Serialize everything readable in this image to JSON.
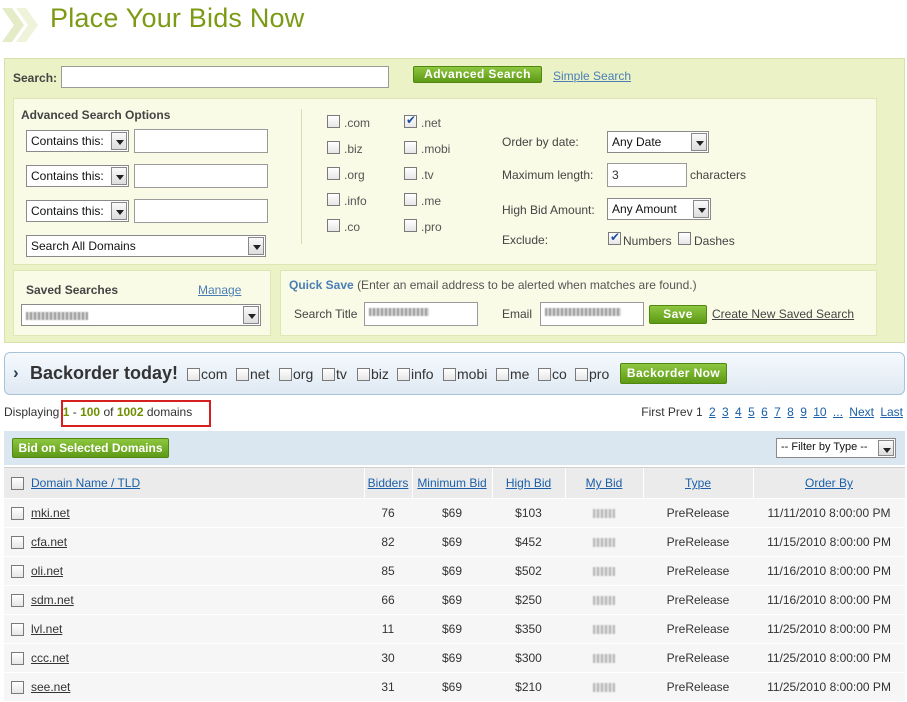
{
  "header": {
    "title": "Place Your Bids Now"
  },
  "search": {
    "label": "Search:",
    "value": "",
    "advanced_button": "Advanced Search",
    "simple_link": "Simple Search"
  },
  "advanced": {
    "title": "Advanced Search Options",
    "contains_rows": [
      {
        "select": "Contains this:",
        "value": ""
      },
      {
        "select": "Contains this:",
        "value": ""
      },
      {
        "select": "Contains this:",
        "value": ""
      }
    ],
    "scope_select": "Search All Domains",
    "tlds": [
      {
        "label": ".com",
        "checked": false
      },
      {
        "label": ".net",
        "checked": true
      },
      {
        "label": ".biz",
        "checked": false
      },
      {
        "label": ".mobi",
        "checked": false
      },
      {
        "label": ".org",
        "checked": false
      },
      {
        "label": ".tv",
        "checked": false
      },
      {
        "label": ".info",
        "checked": false
      },
      {
        "label": ".me",
        "checked": false
      },
      {
        "label": ".co",
        "checked": false
      },
      {
        "label": ".pro",
        "checked": false
      }
    ],
    "order_by_date_label": "Order by date:",
    "order_by_date_value": "Any Date",
    "max_length_label": "Maximum length:",
    "max_length_value": "3",
    "max_length_unit": "characters",
    "high_bid_label": "High Bid Amount:",
    "high_bid_value": "Any Amount",
    "exclude_label": "Exclude:",
    "exclude_numbers": "Numbers",
    "exclude_numbers_checked": true,
    "exclude_dashes": "Dashes",
    "exclude_dashes_checked": false
  },
  "saved": {
    "title": "Saved Searches",
    "manage": "Manage"
  },
  "quick_save": {
    "title": "Quick Save",
    "hint": "(Enter an email address to be alerted when matches are found.)",
    "search_title_label": "Search Title",
    "email_label": "Email",
    "save_button": "Save",
    "create_link": "Create New Saved Search"
  },
  "backorder": {
    "title": "Backorder today!",
    "tlds": [
      "com",
      "net",
      "org",
      "tv",
      "biz",
      "info",
      "mobi",
      "me",
      "co",
      "pro"
    ],
    "button": "Backorder Now"
  },
  "results": {
    "prefix": "Displaying",
    "from": "1",
    "dash": "-",
    "to": "100",
    "of": "of",
    "total": "1002",
    "suffix": "domains",
    "pager": {
      "first": "First",
      "prev": "Prev",
      "current": "1",
      "pages": [
        "2",
        "3",
        "4",
        "5",
        "6",
        "7",
        "8",
        "9",
        "10"
      ],
      "more": "...",
      "next": "Next",
      "last": "Last"
    }
  },
  "toolbar": {
    "bid_button": "Bid on Selected Domains",
    "filter_select": "-- Filter by Type --"
  },
  "table": {
    "headers": [
      "Domain Name / TLD",
      "Bidders",
      "Minimum Bid",
      "High Bid",
      "My Bid",
      "Type",
      "Order By"
    ],
    "rows": [
      {
        "domain": "mki.net",
        "bidders": "76",
        "min_bid": "$69",
        "high_bid": "$103",
        "type": "PreRelease",
        "order_by": "11/11/2010 8:00:00 PM"
      },
      {
        "domain": "cfa.net",
        "bidders": "82",
        "min_bid": "$69",
        "high_bid": "$452",
        "type": "PreRelease",
        "order_by": "11/15/2010 8:00:00 PM"
      },
      {
        "domain": "oli.net",
        "bidders": "85",
        "min_bid": "$69",
        "high_bid": "$502",
        "type": "PreRelease",
        "order_by": "11/16/2010 8:00:00 PM"
      },
      {
        "domain": "sdm.net",
        "bidders": "66",
        "min_bid": "$69",
        "high_bid": "$250",
        "type": "PreRelease",
        "order_by": "11/16/2010 8:00:00 PM"
      },
      {
        "domain": "lvl.net",
        "bidders": "11",
        "min_bid": "$69",
        "high_bid": "$350",
        "type": "PreRelease",
        "order_by": "11/25/2010 8:00:00 PM"
      },
      {
        "domain": "ccc.net",
        "bidders": "30",
        "min_bid": "$69",
        "high_bid": "$300",
        "type": "PreRelease",
        "order_by": "11/25/2010 8:00:00 PM"
      },
      {
        "domain": "see.net",
        "bidders": "31",
        "min_bid": "$69",
        "high_bid": "$210",
        "type": "PreRelease",
        "order_by": "11/25/2010 8:00:00 PM"
      }
    ]
  },
  "colors": {
    "title_green": "#7c9a14",
    "panel_green": "#ebf2c5",
    "button_green": "#6ea620",
    "link_blue": "#1b5fa8",
    "highlight_red": "#d62020"
  }
}
